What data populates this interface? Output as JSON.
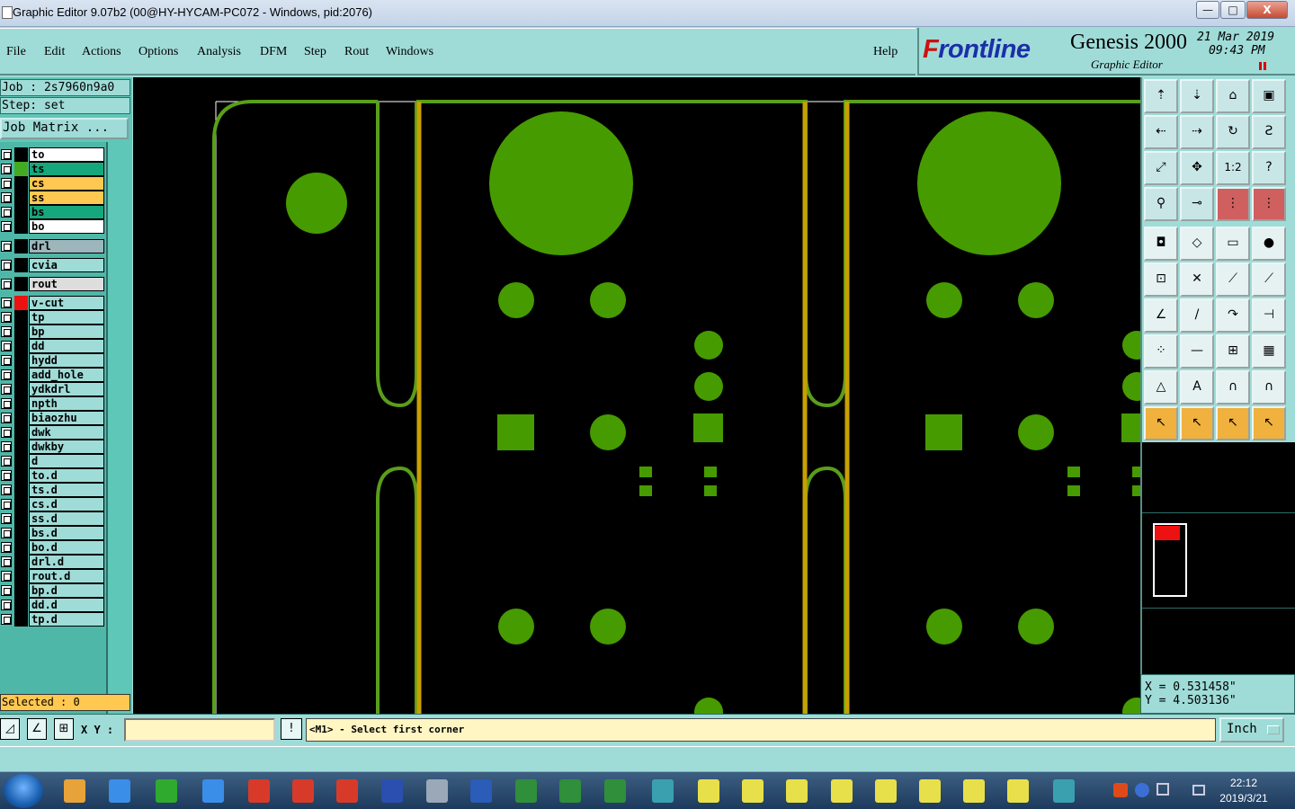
{
  "window": {
    "title": "Graphic Editor 9.07b2 (00@HY-HYCAM-PC072 - Windows, pid:2076)",
    "min_label": "—",
    "max_label": "□",
    "close_label": "X"
  },
  "menu": {
    "file": "File",
    "edit": "Edit",
    "actions": "Actions",
    "options": "Options",
    "analysis": "Analysis",
    "dfm": "DFM",
    "step": "Step",
    "rout": "Rout",
    "windows": "Windows",
    "help": "Help"
  },
  "brand": {
    "logo_a": "F",
    "logo_b": "r",
    "logo_c": "ontline",
    "product": "Genesis 2000",
    "subtitle": "Graphic Editor",
    "date": "21 Mar 2019",
    "time": "09:43 PM"
  },
  "job": {
    "job_line": "Job : 2s7960n9a0",
    "step_line": "Step: set",
    "matrix_button": "Job Matrix ..."
  },
  "layers": [
    {
      "name": "to",
      "swatch": "#000000",
      "bg": "#ffffff"
    },
    {
      "name": "ts",
      "swatch": "#44aa22",
      "bg": "#16a87c"
    },
    {
      "name": "cs",
      "swatch": "#000000",
      "bg": "#ffc850"
    },
    {
      "name": "ss",
      "swatch": "#000000",
      "bg": "#ffc850"
    },
    {
      "name": "bs",
      "swatch": "#000000",
      "bg": "#16a87c"
    },
    {
      "name": "bo",
      "swatch": "#000000",
      "bg": "#ffffff"
    },
    {
      "name": "drl",
      "swatch": "#000000",
      "bg": "#9cb6bc"
    },
    {
      "name": "cvia",
      "swatch": "#000000",
      "bg": "#9fdcd8"
    },
    {
      "name": "rout",
      "swatch": "#000000",
      "bg": "#dddddd"
    },
    {
      "name": "v-cut",
      "swatch": "#ee1111",
      "bg": "#9fdcd8"
    },
    {
      "name": "tp",
      "swatch": "#000000",
      "bg": "#9fdcd8"
    },
    {
      "name": "bp",
      "swatch": "#000000",
      "bg": "#9fdcd8"
    },
    {
      "name": "dd",
      "swatch": "#000000",
      "bg": "#9fdcd8"
    },
    {
      "name": "hydd",
      "swatch": "#000000",
      "bg": "#9fdcd8"
    },
    {
      "name": "add_hole",
      "swatch": "#000000",
      "bg": "#9fdcd8"
    },
    {
      "name": "ydkdrl",
      "swatch": "#000000",
      "bg": "#9fdcd8"
    },
    {
      "name": "npth",
      "swatch": "#000000",
      "bg": "#9fdcd8"
    },
    {
      "name": "biaozhu",
      "swatch": "#000000",
      "bg": "#9fdcd8"
    },
    {
      "name": "dwk",
      "swatch": "#000000",
      "bg": "#9fdcd8"
    },
    {
      "name": "dwkby",
      "swatch": "#000000",
      "bg": "#9fdcd8"
    },
    {
      "name": "d",
      "swatch": "#000000",
      "bg": "#9fdcd8"
    },
    {
      "name": "to.d",
      "swatch": "#000000",
      "bg": "#9fdcd8"
    },
    {
      "name": "ts.d",
      "swatch": "#000000",
      "bg": "#9fdcd8"
    },
    {
      "name": "cs.d",
      "swatch": "#000000",
      "bg": "#9fdcd8"
    },
    {
      "name": "ss.d",
      "swatch": "#000000",
      "bg": "#9fdcd8"
    },
    {
      "name": "bs.d",
      "swatch": "#000000",
      "bg": "#9fdcd8"
    },
    {
      "name": "bo.d",
      "swatch": "#000000",
      "bg": "#9fdcd8"
    },
    {
      "name": "drl.d",
      "swatch": "#000000",
      "bg": "#9fdcd8"
    },
    {
      "name": "rout.d",
      "swatch": "#000000",
      "bg": "#9fdcd8"
    },
    {
      "name": "bp.d",
      "swatch": "#000000",
      "bg": "#9fdcd8"
    },
    {
      "name": "dd.d",
      "swatch": "#000000",
      "bg": "#9fdcd8"
    },
    {
      "name": "tp.d",
      "swatch": "#000000",
      "bg": "#9fdcd8"
    }
  ],
  "selected": "Selected : 0",
  "coords": {
    "x": "X = 0.531458\"",
    "y": "Y = 4.503136\""
  },
  "status": {
    "xy_label": "X Y :",
    "xy_value": "",
    "prompt": "<M1> - Select first corner",
    "unit": "Inch"
  },
  "tools": [
    {
      "icon": "pan-up-icon",
      "glyph": "⇡",
      "style": "n"
    },
    {
      "icon": "pan-down-icon",
      "glyph": "⇣",
      "style": "n"
    },
    {
      "icon": "home-icon",
      "glyph": "⌂",
      "style": "n"
    },
    {
      "icon": "frame-icon",
      "glyph": "▣",
      "style": "n"
    },
    {
      "icon": "pan-left-icon",
      "glyph": "⇠",
      "style": "n"
    },
    {
      "icon": "pan-right-icon",
      "glyph": "⇢",
      "style": "n"
    },
    {
      "icon": "redraw-icon",
      "glyph": "↻",
      "style": "n"
    },
    {
      "icon": "step-icon",
      "glyph": "Ƨ",
      "style": "n"
    },
    {
      "icon": "zoom-fit-icon",
      "glyph": "⤢",
      "style": "n"
    },
    {
      "icon": "zoom-center-icon",
      "glyph": "✥",
      "style": "n"
    },
    {
      "icon": "zoom-1-2-icon",
      "glyph": "1:2",
      "style": "n"
    },
    {
      "icon": "query-icon",
      "glyph": "?",
      "style": "n"
    },
    {
      "icon": "measure-icon",
      "glyph": "⚲",
      "style": "n"
    },
    {
      "icon": "snap-icon",
      "glyph": "⊸",
      "style": "n"
    },
    {
      "icon": "layers-left-icon",
      "glyph": "⋮",
      "style": "rd"
    },
    {
      "icon": "layers-right-icon",
      "glyph": "⋮",
      "style": "rd"
    },
    {
      "icon": "pad-icon",
      "glyph": "◘",
      "style": "dk"
    },
    {
      "icon": "rotate-shape-icon",
      "glyph": "◇",
      "style": "dk"
    },
    {
      "icon": "ruler-icon",
      "glyph": "▭",
      "style": "dk"
    },
    {
      "icon": "circle-icon",
      "glyph": "●",
      "style": "dk"
    },
    {
      "icon": "connect-nodes-icon",
      "glyph": "⊡",
      "style": "dk"
    },
    {
      "icon": "cross-icon",
      "glyph": "✕",
      "style": "dk"
    },
    {
      "icon": "line-point-icon",
      "glyph": "⟋",
      "style": "dk"
    },
    {
      "icon": "line-node-icon",
      "glyph": "⟋",
      "style": "dk"
    },
    {
      "icon": "angle-icon",
      "glyph": "∠",
      "style": "dk"
    },
    {
      "icon": "slash-icon",
      "glyph": "/",
      "style": "dk"
    },
    {
      "icon": "arc-icon",
      "glyph": "↷",
      "style": "dk"
    },
    {
      "icon": "split-icon",
      "glyph": "⊣",
      "style": "dk"
    },
    {
      "icon": "move-point-icon",
      "glyph": "⁘",
      "style": "dk"
    },
    {
      "icon": "minus-icon",
      "glyph": "—",
      "style": "dk"
    },
    {
      "icon": "align-icon",
      "glyph": "⊞",
      "style": "dk"
    },
    {
      "icon": "group-icon",
      "glyph": "▦",
      "style": "dk"
    },
    {
      "icon": "triangle-icon",
      "glyph": "△",
      "style": "dk"
    },
    {
      "icon": "triangle-a-icon",
      "glyph": "A",
      "style": "dk"
    },
    {
      "icon": "arch-icon",
      "glyph": "∩",
      "style": "dk"
    },
    {
      "icon": "arch-b-icon",
      "glyph": "∩",
      "style": "dk"
    },
    {
      "icon": "cursor-icon",
      "glyph": "↖",
      "style": "or"
    },
    {
      "icon": "cursor-box-icon",
      "glyph": "↖",
      "style": "or"
    },
    {
      "icon": "cursor-diamond-icon",
      "glyph": "↖",
      "style": "or"
    },
    {
      "icon": "cursor-path-icon",
      "glyph": "↖",
      "style": "or"
    }
  ],
  "taskbar": {
    "time": "22:12",
    "date": "2019/3/21"
  },
  "colors": {
    "pad": "#469b00",
    "trace": "#5a9e1a",
    "vcut": "#c8a000",
    "panel": "#9fdcd8"
  }
}
